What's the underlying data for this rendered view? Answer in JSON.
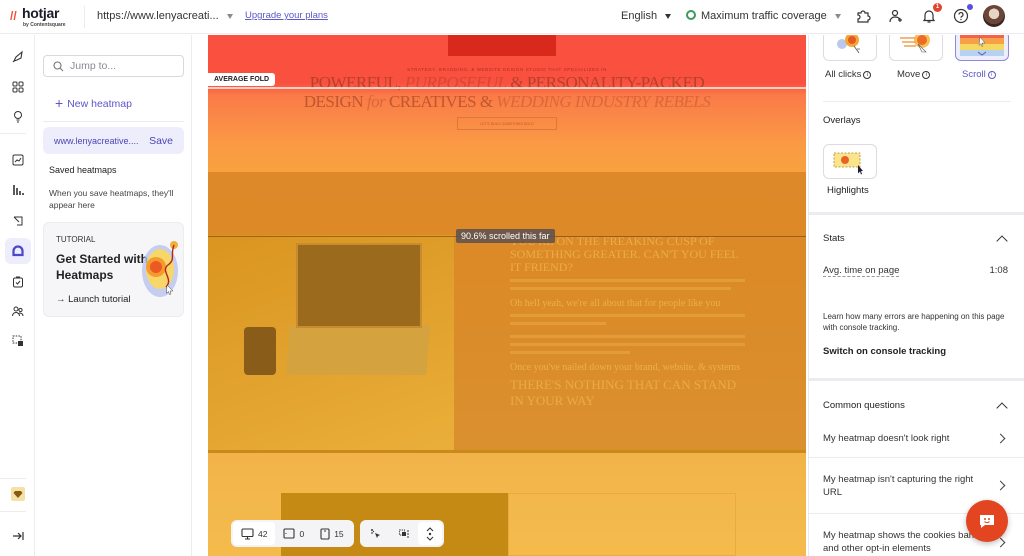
{
  "topbar": {
    "logo": "hotjar",
    "logo_sub": "by Contentsquare",
    "site_url": "https://www.lenyacreati...",
    "upgrade_link": "Upgrade your plans",
    "language": "English",
    "traffic": "Maximum traffic coverage",
    "notifications_count": "1",
    "icons": [
      "puzzle-icon",
      "add-user-icon",
      "bell-icon",
      "help-icon",
      "avatar"
    ]
  },
  "rail": {
    "icons": [
      "rocket-icon",
      "dashboard-icon",
      "lightbulb-icon",
      "trends-icon",
      "funnels-icon",
      "recordings-icon",
      "heatmaps-icon",
      "surveys-icon",
      "interviews-icon",
      "highlights-icon",
      "plan-gem-icon",
      "collapse-icon"
    ],
    "active": "heatmaps-icon"
  },
  "sidebar": {
    "search_placeholder": "Jump to...",
    "new_heatmap": "New heatmap",
    "current_url": "www.lenyacreative....",
    "save": "Save",
    "saved_heading": "Saved heatmaps",
    "saved_empty": "When you save heatmaps, they'll appear here",
    "tutorial": {
      "label": "TUTORIAL",
      "title": "Get Started with Heatmaps",
      "launch": "Launch tutorial"
    }
  },
  "heatmap": {
    "tagline": "STRATEGY, BRANDING, & WEBSITE DESIGN STUDIO THAT SPECIALIZES IN",
    "headline_1a": "POWERFUL, ",
    "headline_1b": "PURPOSEFUL",
    "headline_1c": " & PERSONALITY-PACKED",
    "headline_2a": "DESIGN ",
    "headline_2b": "for",
    "headline_2c": " CREATIVES & ",
    "headline_2d": "WEDDING INDUSTRY REBELS",
    "cta": "LET'S BUILD SOMETHING BOLD",
    "fold_label": "AVERAGE FOLD",
    "scroll_tooltip": "90.6% scrolled this far",
    "scroll_percent": 90.6,
    "copy_h1": "YOU'RE ON THE FREAKING CUSP OF SOMETHING GREATER. CAN'T YOU FEEL IT FRIEND?",
    "copy_h2": "Oh hell yeah, we're all about that for people like you",
    "copy_h3": "Once you've nailed down your brand, website, & systems",
    "copy_h4": "THERE'S NOTHING THAT CAN STAND IN YOUR WAY"
  },
  "toolbar": {
    "desktop_count": "42",
    "tablet_count": "0",
    "mobile_count": "15"
  },
  "panel": {
    "modes": [
      {
        "label": "All clicks",
        "selected": false
      },
      {
        "label": "Move",
        "selected": false
      },
      {
        "label": "Scroll",
        "selected": true
      }
    ],
    "overlays_heading": "Overlays",
    "highlights": "Highlights",
    "stats_heading": "Stats",
    "avg_time_label": "Avg. time on page",
    "avg_time_value": "1:08",
    "console_text": "Learn how many errors are happening on this page with console tracking.",
    "console_link": "Switch on console tracking",
    "questions_heading": "Common questions",
    "questions": [
      "My heatmap doesn't look right",
      "My heatmap isn't capturing the right URL",
      "My heatmap shows the cookies banner and other opt-in elements"
    ]
  },
  "colors": {
    "accent": "#5b57c8",
    "brand": "#f2503c",
    "heat_top": "#f95040",
    "heat_bottom": "#f4bb4c"
  }
}
